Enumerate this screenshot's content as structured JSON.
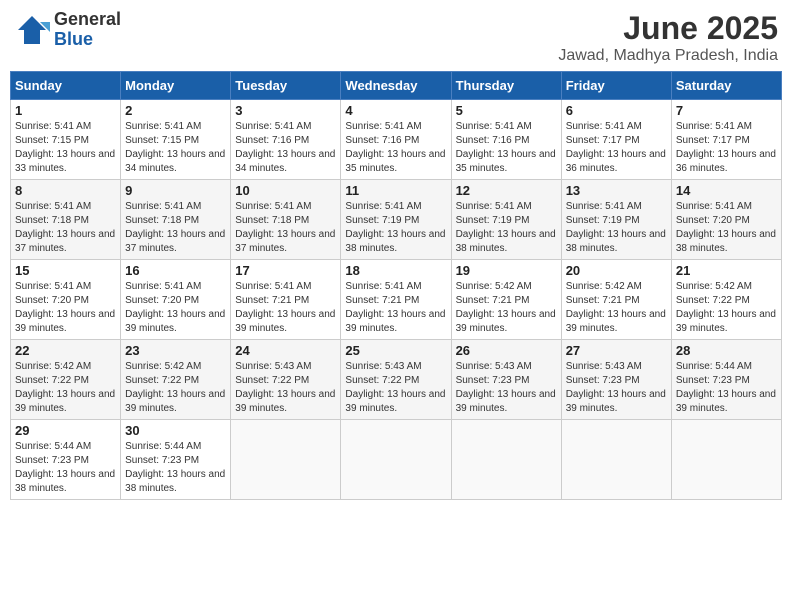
{
  "header": {
    "logo_general": "General",
    "logo_blue": "Blue",
    "month_title": "June 2025",
    "location": "Jawad, Madhya Pradesh, India"
  },
  "weekdays": [
    "Sunday",
    "Monday",
    "Tuesday",
    "Wednesday",
    "Thursday",
    "Friday",
    "Saturday"
  ],
  "weeks": [
    [
      {
        "day": "1",
        "sunrise": "5:41 AM",
        "sunset": "7:15 PM",
        "daylight": "13 hours and 33 minutes."
      },
      {
        "day": "2",
        "sunrise": "5:41 AM",
        "sunset": "7:15 PM",
        "daylight": "13 hours and 34 minutes."
      },
      {
        "day": "3",
        "sunrise": "5:41 AM",
        "sunset": "7:16 PM",
        "daylight": "13 hours and 34 minutes."
      },
      {
        "day": "4",
        "sunrise": "5:41 AM",
        "sunset": "7:16 PM",
        "daylight": "13 hours and 35 minutes."
      },
      {
        "day": "5",
        "sunrise": "5:41 AM",
        "sunset": "7:16 PM",
        "daylight": "13 hours and 35 minutes."
      },
      {
        "day": "6",
        "sunrise": "5:41 AM",
        "sunset": "7:17 PM",
        "daylight": "13 hours and 36 minutes."
      },
      {
        "day": "7",
        "sunrise": "5:41 AM",
        "sunset": "7:17 PM",
        "daylight": "13 hours and 36 minutes."
      }
    ],
    [
      {
        "day": "8",
        "sunrise": "5:41 AM",
        "sunset": "7:18 PM",
        "daylight": "13 hours and 37 minutes."
      },
      {
        "day": "9",
        "sunrise": "5:41 AM",
        "sunset": "7:18 PM",
        "daylight": "13 hours and 37 minutes."
      },
      {
        "day": "10",
        "sunrise": "5:41 AM",
        "sunset": "7:18 PM",
        "daylight": "13 hours and 37 minutes."
      },
      {
        "day": "11",
        "sunrise": "5:41 AM",
        "sunset": "7:19 PM",
        "daylight": "13 hours and 38 minutes."
      },
      {
        "day": "12",
        "sunrise": "5:41 AM",
        "sunset": "7:19 PM",
        "daylight": "13 hours and 38 minutes."
      },
      {
        "day": "13",
        "sunrise": "5:41 AM",
        "sunset": "7:19 PM",
        "daylight": "13 hours and 38 minutes."
      },
      {
        "day": "14",
        "sunrise": "5:41 AM",
        "sunset": "7:20 PM",
        "daylight": "13 hours and 38 minutes."
      }
    ],
    [
      {
        "day": "15",
        "sunrise": "5:41 AM",
        "sunset": "7:20 PM",
        "daylight": "13 hours and 39 minutes."
      },
      {
        "day": "16",
        "sunrise": "5:41 AM",
        "sunset": "7:20 PM",
        "daylight": "13 hours and 39 minutes."
      },
      {
        "day": "17",
        "sunrise": "5:41 AM",
        "sunset": "7:21 PM",
        "daylight": "13 hours and 39 minutes."
      },
      {
        "day": "18",
        "sunrise": "5:41 AM",
        "sunset": "7:21 PM",
        "daylight": "13 hours and 39 minutes."
      },
      {
        "day": "19",
        "sunrise": "5:42 AM",
        "sunset": "7:21 PM",
        "daylight": "13 hours and 39 minutes."
      },
      {
        "day": "20",
        "sunrise": "5:42 AM",
        "sunset": "7:21 PM",
        "daylight": "13 hours and 39 minutes."
      },
      {
        "day": "21",
        "sunrise": "5:42 AM",
        "sunset": "7:22 PM",
        "daylight": "13 hours and 39 minutes."
      }
    ],
    [
      {
        "day": "22",
        "sunrise": "5:42 AM",
        "sunset": "7:22 PM",
        "daylight": "13 hours and 39 minutes."
      },
      {
        "day": "23",
        "sunrise": "5:42 AM",
        "sunset": "7:22 PM",
        "daylight": "13 hours and 39 minutes."
      },
      {
        "day": "24",
        "sunrise": "5:43 AM",
        "sunset": "7:22 PM",
        "daylight": "13 hours and 39 minutes."
      },
      {
        "day": "25",
        "sunrise": "5:43 AM",
        "sunset": "7:22 PM",
        "daylight": "13 hours and 39 minutes."
      },
      {
        "day": "26",
        "sunrise": "5:43 AM",
        "sunset": "7:23 PM",
        "daylight": "13 hours and 39 minutes."
      },
      {
        "day": "27",
        "sunrise": "5:43 AM",
        "sunset": "7:23 PM",
        "daylight": "13 hours and 39 minutes."
      },
      {
        "day": "28",
        "sunrise": "5:44 AM",
        "sunset": "7:23 PM",
        "daylight": "13 hours and 39 minutes."
      }
    ],
    [
      {
        "day": "29",
        "sunrise": "5:44 AM",
        "sunset": "7:23 PM",
        "daylight": "13 hours and 38 minutes."
      },
      {
        "day": "30",
        "sunrise": "5:44 AM",
        "sunset": "7:23 PM",
        "daylight": "13 hours and 38 minutes."
      },
      null,
      null,
      null,
      null,
      null
    ]
  ]
}
